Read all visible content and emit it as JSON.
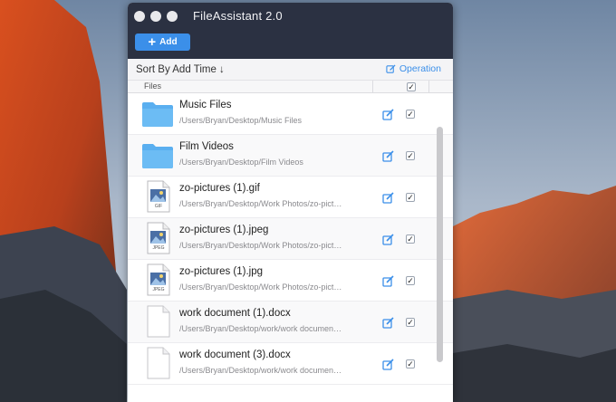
{
  "window": {
    "title": "FileAssistant 2.0"
  },
  "toolbar": {
    "add_label": "Add"
  },
  "sortbar": {
    "sort_label": "Sort By Add Time ↓",
    "operation_label": "Operation"
  },
  "columns": {
    "files_header": "Files"
  },
  "files": [
    {
      "name": "Music Files",
      "path": "/Users/Bryan/Desktop/Music Files",
      "type": "folder",
      "checked": true
    },
    {
      "name": "Film Videos",
      "path": "/Users/Bryan/Desktop/Film Videos",
      "type": "folder",
      "checked": true
    },
    {
      "name": "zo-pictures (1).gif",
      "path": "/Users/Bryan/Desktop/Work Photos/zo-pict…",
      "type": "image",
      "badge": "GIF",
      "checked": true
    },
    {
      "name": "zo-pictures (1).jpeg",
      "path": "/Users/Bryan/Desktop/Work Photos/zo-pict…",
      "type": "image",
      "badge": "JPEG",
      "checked": true
    },
    {
      "name": "zo-pictures (1).jpg",
      "path": "/Users/Bryan/Desktop/Work Photos/zo-pict…",
      "type": "image",
      "badge": "JPEG",
      "checked": true
    },
    {
      "name": "work document (1).docx",
      "path": "/Users/Bryan/Desktop/work/work documen…",
      "type": "document",
      "checked": true
    },
    {
      "name": "work document (3).docx",
      "path": "/Users/Bryan/Desktop/work/work documen…",
      "type": "document",
      "checked": true
    }
  ],
  "colors": {
    "accent": "#3b8fe9",
    "titlebar": "#2b3142",
    "folder": "#5aaff0"
  }
}
